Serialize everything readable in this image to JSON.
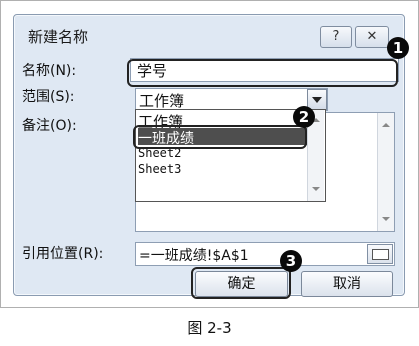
{
  "dialog": {
    "title": "新建名称",
    "help_label": "?",
    "close_label": "✕"
  },
  "form": {
    "name_label": "名称(N):",
    "name_value": "学号",
    "scope_label": "范围(S):",
    "scope_value": "工作簿",
    "comment_label": "备注(O):",
    "ref_label": "引用位置(R):",
    "ref_value": "=一班成绩!$A$1"
  },
  "scope_options": [
    "工作簿",
    "一班成绩",
    "Sheet2",
    "Sheet3"
  ],
  "selected_option": "一班成绩",
  "buttons": {
    "ok": "确定",
    "cancel": "取消"
  },
  "markers": [
    "1",
    "2",
    "3"
  ],
  "caption": "图 2-3",
  "colors": {
    "dialog_bg": "#dfe8f3",
    "selection": "#4e4e4e",
    "marker": "#0a0a0a"
  }
}
